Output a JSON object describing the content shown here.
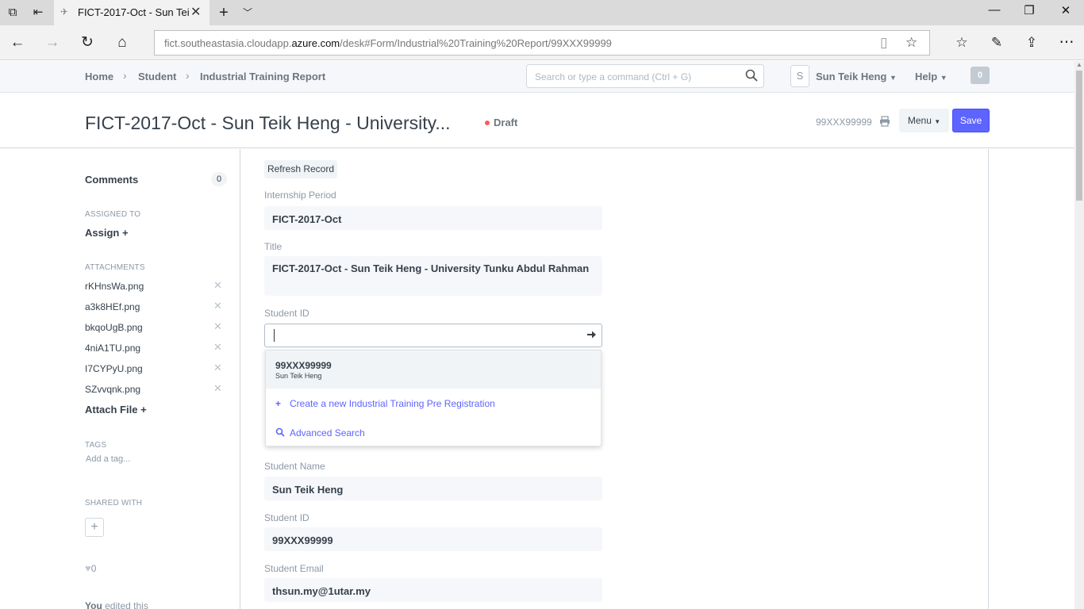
{
  "browser": {
    "tab_title": "FICT-2017-Oct - Sun Tei",
    "url_prefix": "fict.southeastasia.cloudapp.",
    "url_domain": "azure.com",
    "url_suffix": "/desk#Form/Industrial%20Training%20Report/99XXX99999"
  },
  "app_nav": {
    "breadcrumbs": [
      "Home",
      "Student",
      "Industrial Training Report"
    ],
    "search_placeholder": "Search or type a command (Ctrl + G)",
    "avatar_letter": "S",
    "user_name": "Sun Teik Heng",
    "help_label": "Help",
    "notification_count": "0"
  },
  "page_head": {
    "title": "FICT-2017-Oct - Sun Teik Heng - University...",
    "status": "Draft",
    "doc_id": "99XXX99999",
    "menu_label": "Menu",
    "save_label": "Save"
  },
  "sidebar": {
    "comments_label": "Comments",
    "comments_count": "0",
    "assigned_to_heading": "ASSIGNED TO",
    "assign_label": "Assign +",
    "attachments_heading": "ATTACHMENTS",
    "attachments": [
      "rKHnsWa.png",
      "a3k8HEf.png",
      "bkqoUgB.png",
      "4niA1TU.png",
      "I7CYPyU.png",
      "SZvvqnk.png"
    ],
    "attach_file_label": "Attach File +",
    "tags_heading": "TAGS",
    "add_tag_label": "Add a tag...",
    "shared_with_heading": "SHARED WITH",
    "like_count": "0",
    "edited_user": "You",
    "edited_text": " edited this"
  },
  "form": {
    "refresh_label": "Refresh Record",
    "internship_period_label": "Internship Period",
    "internship_period_value": "FICT-2017-Oct",
    "title_label": "Title",
    "title_value": "FICT-2017-Oct - Sun Teik Heng - University Tunku Abdul Rahman",
    "student_id_label": "Student ID",
    "student_id_input_value": "",
    "student_name_label": "Student Name",
    "student_name_value": "Sun Teik Heng",
    "student_id2_label": "Student ID",
    "student_id2_value": "99XXX99999",
    "student_email_label": "Student Email",
    "student_email_value": "thsun.my@1utar.my"
  },
  "dropdown": {
    "option_id": "99XXX99999",
    "option_name": "Sun Teik Heng",
    "create_label": "Create a new Industrial Training Pre Registration",
    "advanced_label": "Advanced Search"
  }
}
